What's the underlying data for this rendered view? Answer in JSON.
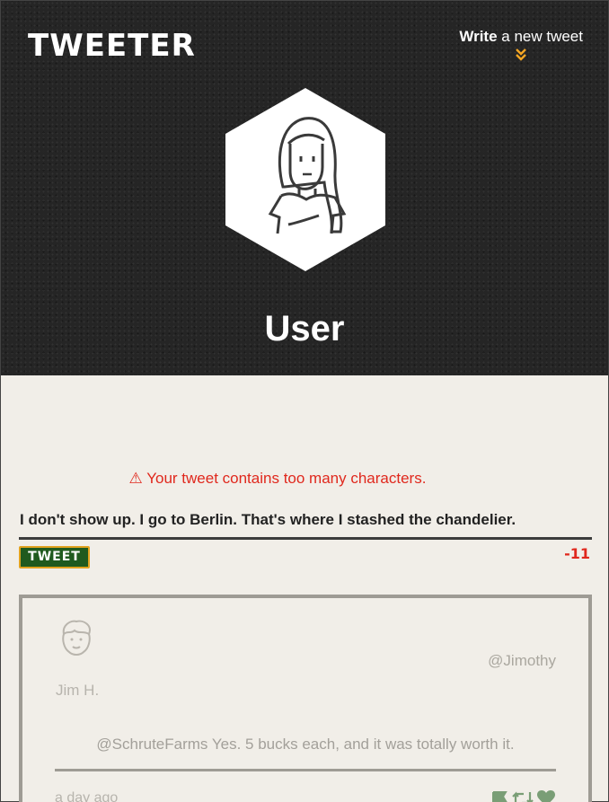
{
  "app": {
    "logo": "TWEETER",
    "compose_bold": "Write",
    "compose_rest": " a new tweet",
    "compose_chevron": "»"
  },
  "profile": {
    "name": "User"
  },
  "composer": {
    "error_message": "Your tweet contains too many characters.",
    "error_icon": "⚠",
    "text": "I don't show up. I go to Berlin. That's where I stashed the chandelier.",
    "submit_label": "TWEET",
    "counter": "-11"
  },
  "tweets": [
    {
      "handle": "@Jimothy",
      "name": "Jim H.",
      "content": "@SchruteFarms Yes. 5 bucks each, and it was totally worth it.",
      "time": "a day ago",
      "icons": [
        "flag-icon",
        "retweet-icon",
        "heart-icon"
      ]
    }
  ],
  "colors": {
    "accent": "#f5a623",
    "error": "#e0281d",
    "button_bg": "#1f5a1e",
    "header_bg": "#252525",
    "page_bg": "#f1eee8"
  }
}
